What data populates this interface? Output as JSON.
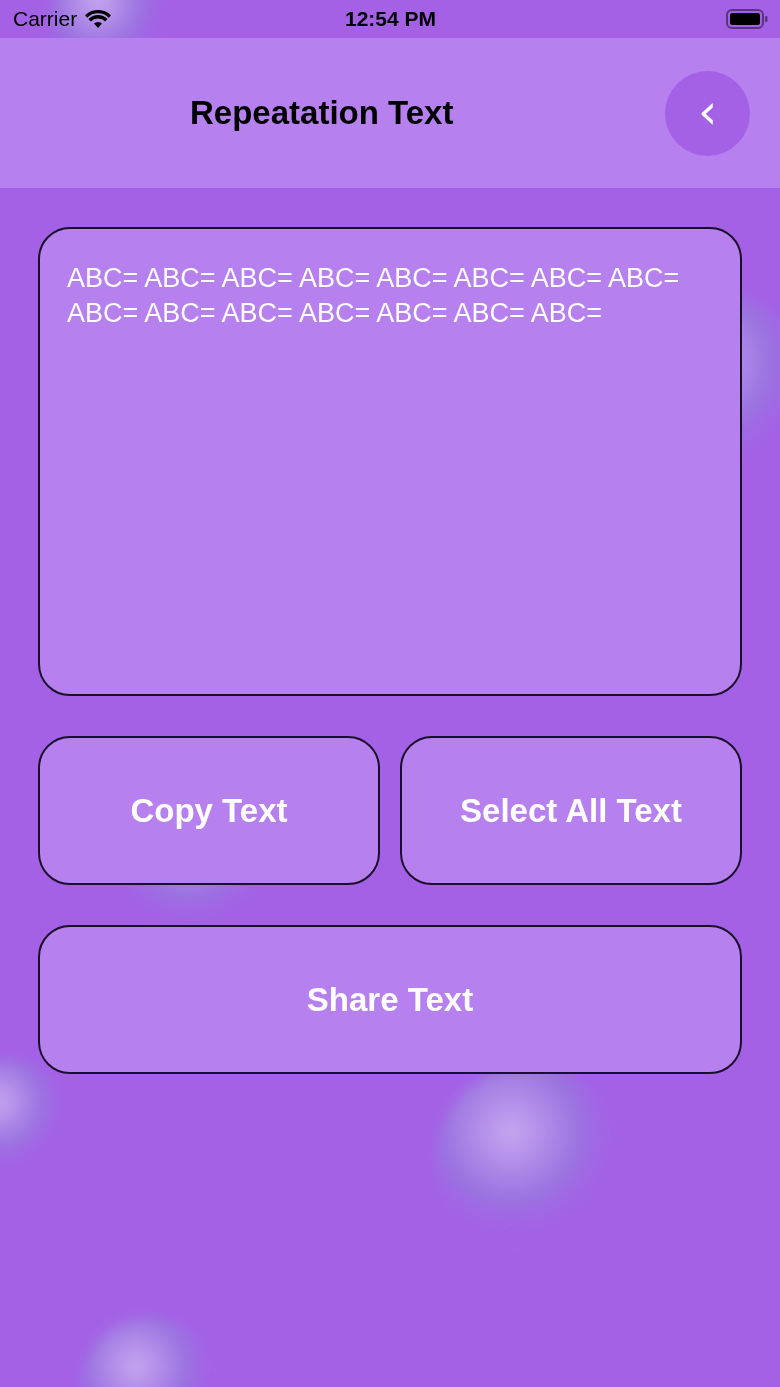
{
  "status_bar": {
    "carrier": "Carrier",
    "time": "12:54 PM"
  },
  "header": {
    "title": "Repeatation Text",
    "back_button": "‹"
  },
  "text_area": {
    "value": "ABC= ABC= ABC= ABC= ABC= ABC= ABC= ABC= ABC= ABC= ABC= ABC= ABC= ABC= ABC="
  },
  "buttons": [
    {
      "label": "Copy Text",
      "kind": "half"
    },
    {
      "label": "Select All Text",
      "kind": "half"
    },
    {
      "label": "Share Text",
      "kind": "full"
    }
  ]
}
